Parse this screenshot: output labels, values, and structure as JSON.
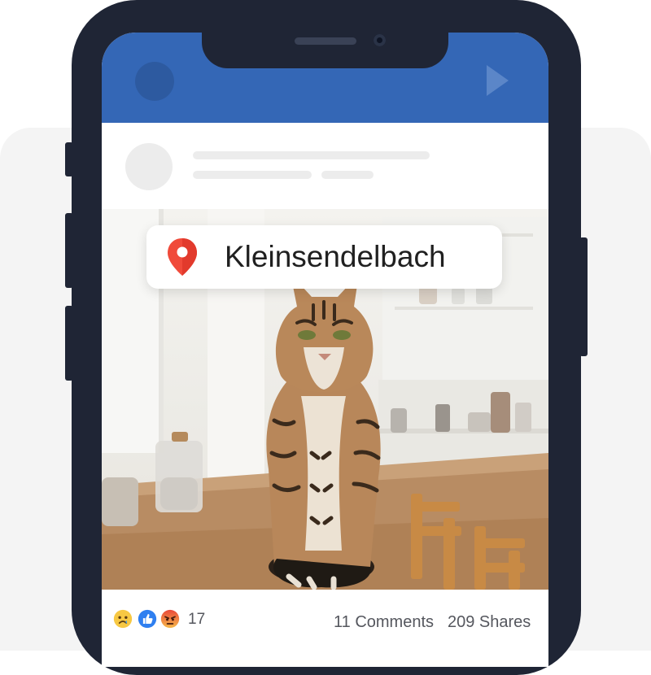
{
  "post": {
    "location": "Kleinsendelbach",
    "reactions": {
      "icons": [
        "sad-reaction-icon",
        "like-reaction-icon",
        "angry-reaction-icon"
      ],
      "count": "17"
    },
    "comments": "11 Comments",
    "shares": "209 Shares"
  },
  "colors": {
    "app_bar": "#3467b6",
    "phone_frame": "#1f2535",
    "pin": "#f04a3a"
  }
}
